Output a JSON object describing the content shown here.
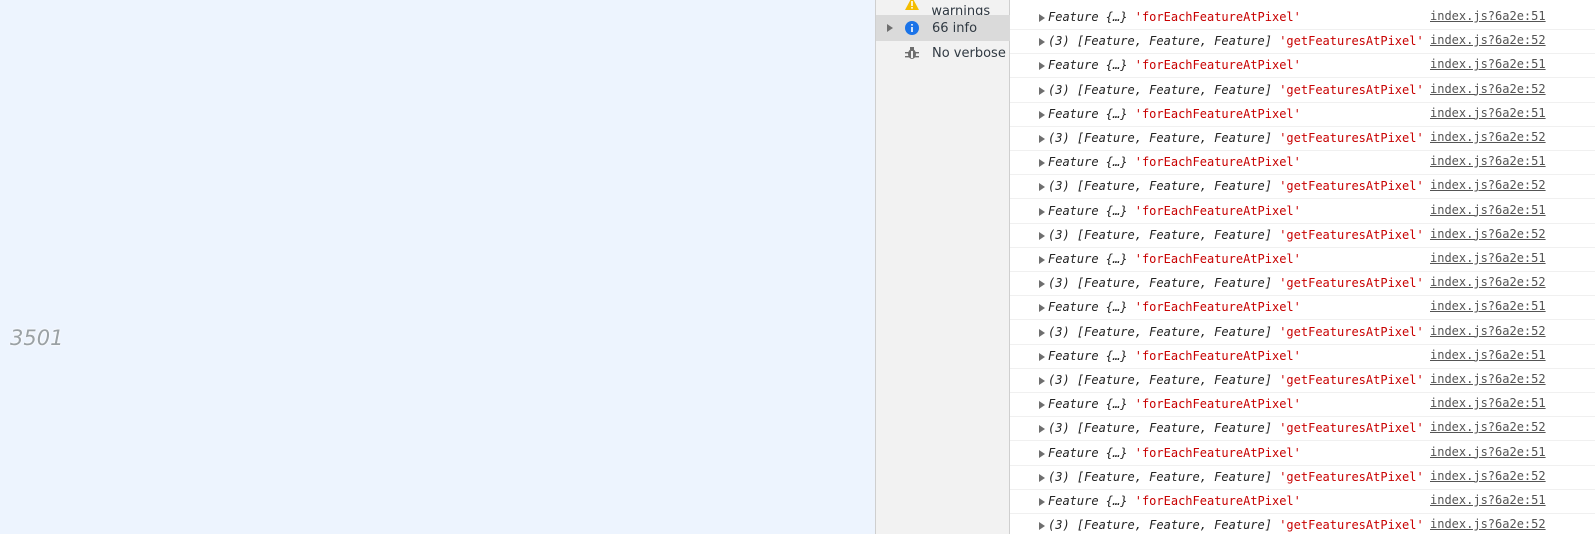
{
  "map": {
    "label": "3501"
  },
  "sidebar": {
    "items": [
      {
        "label": "No warnings",
        "icon": "warning-icon",
        "color": "#f4bd00"
      },
      {
        "label": "66 info",
        "icon": "info-icon",
        "color": "#1a73e8",
        "selected": true
      },
      {
        "label": "No verbose",
        "icon": "bug-icon",
        "color": "#6e6e6e"
      }
    ]
  },
  "console": {
    "rows": [
      {
        "obj": "Feature {…}",
        "str": "'forEachFeatureAtPixel'",
        "src": "index.js?6a2e:51"
      },
      {
        "obj": "(3) [Feature, Feature, Feature]",
        "str": "'getFeaturesAtPixel'",
        "src": "index.js?6a2e:52"
      },
      {
        "obj": "Feature {…}",
        "str": "'forEachFeatureAtPixel'",
        "src": "index.js?6a2e:51"
      },
      {
        "obj": "(3) [Feature, Feature, Feature]",
        "str": "'getFeaturesAtPixel'",
        "src": "index.js?6a2e:52"
      },
      {
        "obj": "Feature {…}",
        "str": "'forEachFeatureAtPixel'",
        "src": "index.js?6a2e:51"
      },
      {
        "obj": "(3) [Feature, Feature, Feature]",
        "str": "'getFeaturesAtPixel'",
        "src": "index.js?6a2e:52"
      },
      {
        "obj": "Feature {…}",
        "str": "'forEachFeatureAtPixel'",
        "src": "index.js?6a2e:51"
      },
      {
        "obj": "(3) [Feature, Feature, Feature]",
        "str": "'getFeaturesAtPixel'",
        "src": "index.js?6a2e:52"
      },
      {
        "obj": "Feature {…}",
        "str": "'forEachFeatureAtPixel'",
        "src": "index.js?6a2e:51"
      },
      {
        "obj": "(3) [Feature, Feature, Feature]",
        "str": "'getFeaturesAtPixel'",
        "src": "index.js?6a2e:52"
      },
      {
        "obj": "Feature {…}",
        "str": "'forEachFeatureAtPixel'",
        "src": "index.js?6a2e:51"
      },
      {
        "obj": "(3) [Feature, Feature, Feature]",
        "str": "'getFeaturesAtPixel'",
        "src": "index.js?6a2e:52"
      },
      {
        "obj": "Feature {…}",
        "str": "'forEachFeatureAtPixel'",
        "src": "index.js?6a2e:51"
      },
      {
        "obj": "(3) [Feature, Feature, Feature]",
        "str": "'getFeaturesAtPixel'",
        "src": "index.js?6a2e:52"
      },
      {
        "obj": "Feature {…}",
        "str": "'forEachFeatureAtPixel'",
        "src": "index.js?6a2e:51"
      },
      {
        "obj": "(3) [Feature, Feature, Feature]",
        "str": "'getFeaturesAtPixel'",
        "src": "index.js?6a2e:52"
      },
      {
        "obj": "Feature {…}",
        "str": "'forEachFeatureAtPixel'",
        "src": "index.js?6a2e:51"
      },
      {
        "obj": "(3) [Feature, Feature, Feature]",
        "str": "'getFeaturesAtPixel'",
        "src": "index.js?6a2e:52"
      },
      {
        "obj": "Feature {…}",
        "str": "'forEachFeatureAtPixel'",
        "src": "index.js?6a2e:51"
      },
      {
        "obj": "(3) [Feature, Feature, Feature]",
        "str": "'getFeaturesAtPixel'",
        "src": "index.js?6a2e:52"
      },
      {
        "obj": "Feature {…}",
        "str": "'forEachFeatureAtPixel'",
        "src": "index.js?6a2e:51"
      },
      {
        "obj": "(3) [Feature, Feature, Feature]",
        "str": "'getFeaturesAtPixel'",
        "src": "index.js?6a2e:52"
      }
    ]
  }
}
